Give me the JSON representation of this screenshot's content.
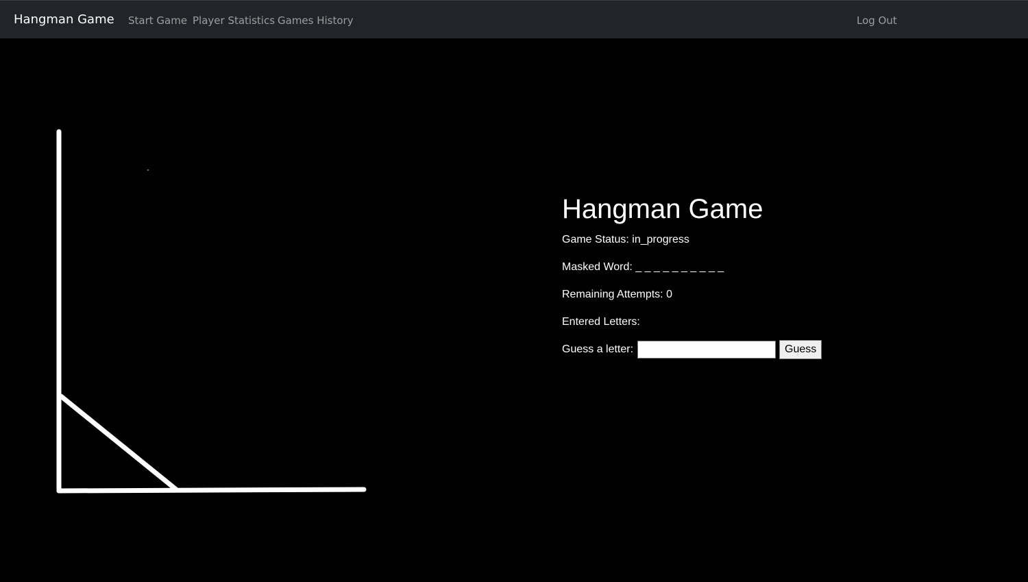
{
  "navbar": {
    "brand": "Hangman Game",
    "links": [
      "Start Game",
      "Player Statistics",
      "Games History"
    ],
    "logout": "Log Out"
  },
  "game": {
    "title": "Hangman Game",
    "status_label": "Game Status:",
    "status_value": "in_progress",
    "masked_label": "Masked Word:",
    "masked_value": "_ _ _ _ _ _ _ _ _ _",
    "attempts_label": "Remaining Attempts:",
    "attempts_value": "0",
    "entered_label": "Entered Letters:",
    "entered_value": "",
    "guess_label": "Guess a letter:",
    "guess_input_value": "",
    "guess_button": "Guess"
  },
  "colors": {
    "navbar_bg": "#212529",
    "page_bg": "#000000",
    "drawing_stroke": "#ffffff"
  }
}
